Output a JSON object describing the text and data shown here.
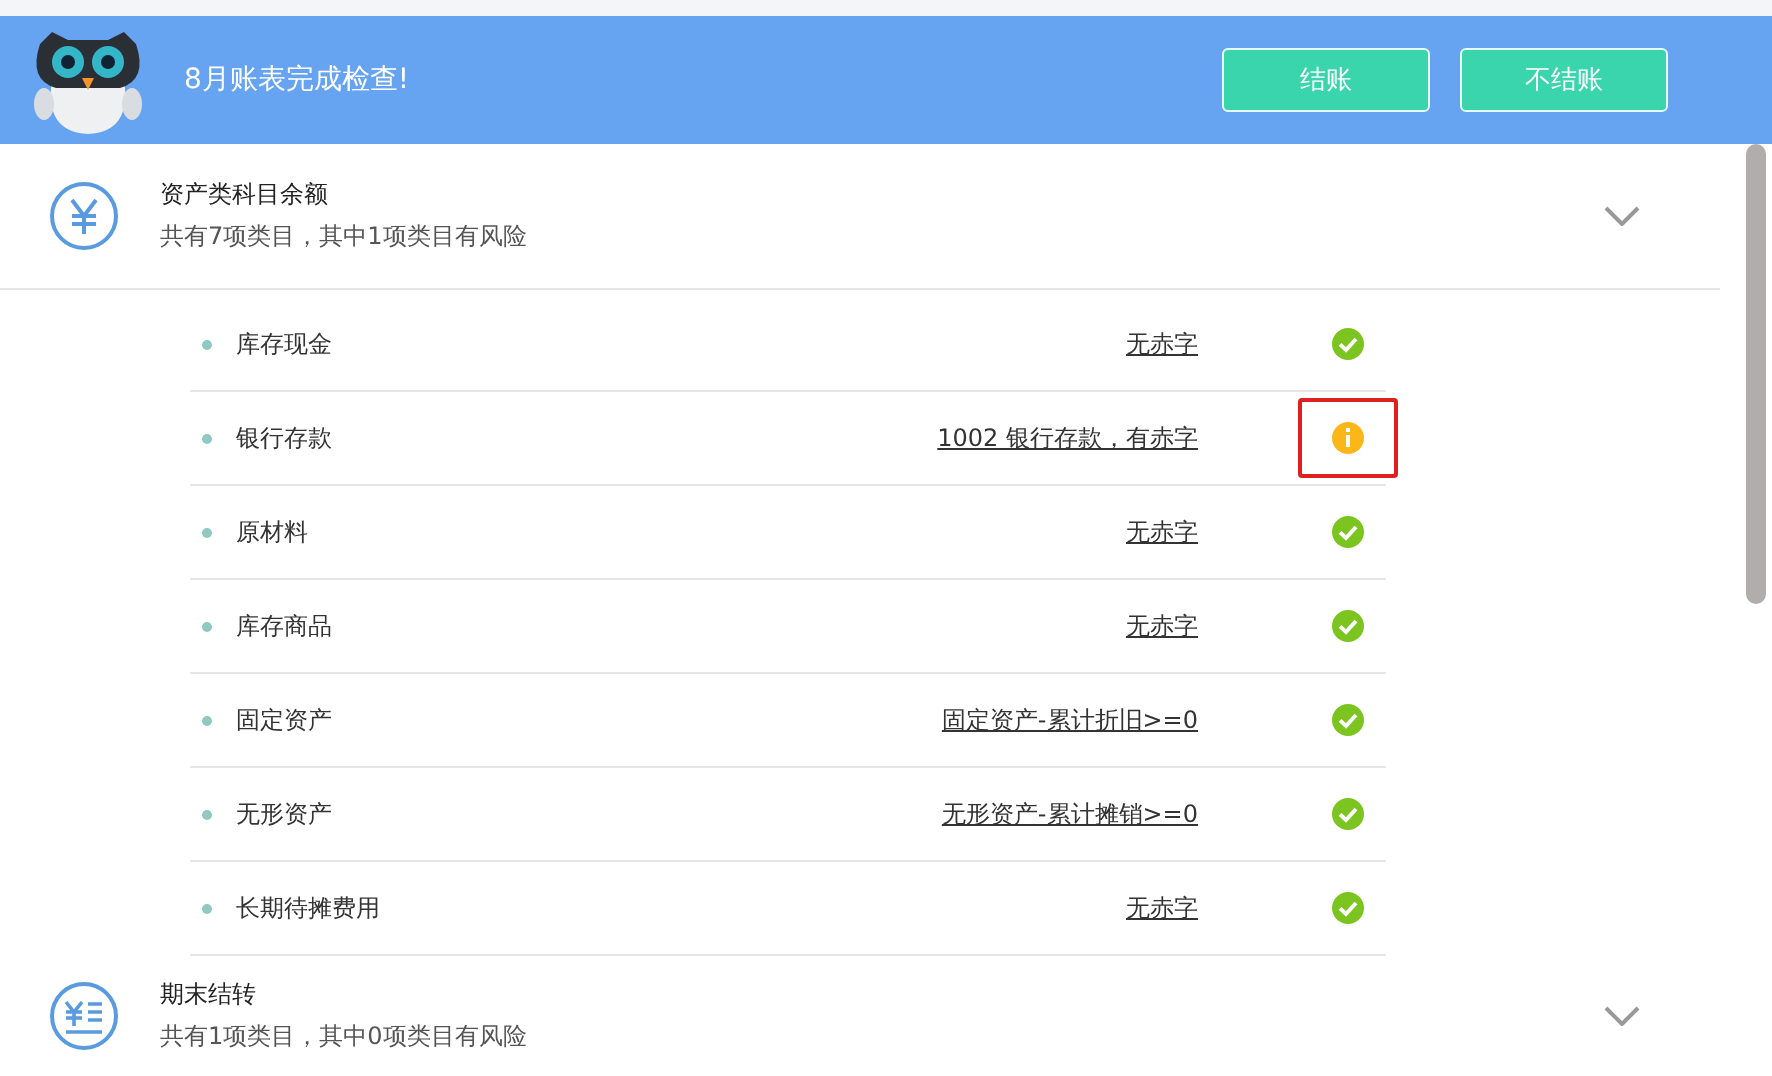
{
  "header": {
    "title": "8月账表完成检查!",
    "buttons": [
      {
        "label": "结账"
      },
      {
        "label": "不结账"
      }
    ]
  },
  "sections": [
    {
      "title": "资产类科目余额",
      "summary": "共有7项类目，其中1项类目有风险",
      "kind": "balance",
      "expanded": true,
      "items": [
        {
          "name": "库存现金",
          "detail": "无赤字",
          "kind": "ok",
          "highlighted": false
        },
        {
          "name": "银行存款",
          "detail": "1002 银行存款，有赤字",
          "kind": "warning",
          "highlighted": true
        },
        {
          "name": "原材料",
          "detail": "无赤字",
          "kind": "ok",
          "highlighted": false
        },
        {
          "name": "库存商品",
          "detail": "无赤字",
          "kind": "ok",
          "highlighted": false
        },
        {
          "name": "固定资产",
          "detail": "固定资产-累计折旧>=0",
          "kind": "ok",
          "highlighted": false
        },
        {
          "name": "无形资产",
          "detail": "无形资产-累计摊销>=0",
          "kind": "ok",
          "highlighted": false
        },
        {
          "name": "长期待摊费用",
          "detail": "无赤字",
          "kind": "ok",
          "highlighted": false
        }
      ]
    },
    {
      "title": "期末结转",
      "summary": "共有1项类目，其中0项类目有风险",
      "kind": "carryover",
      "expanded": false
    }
  ]
}
